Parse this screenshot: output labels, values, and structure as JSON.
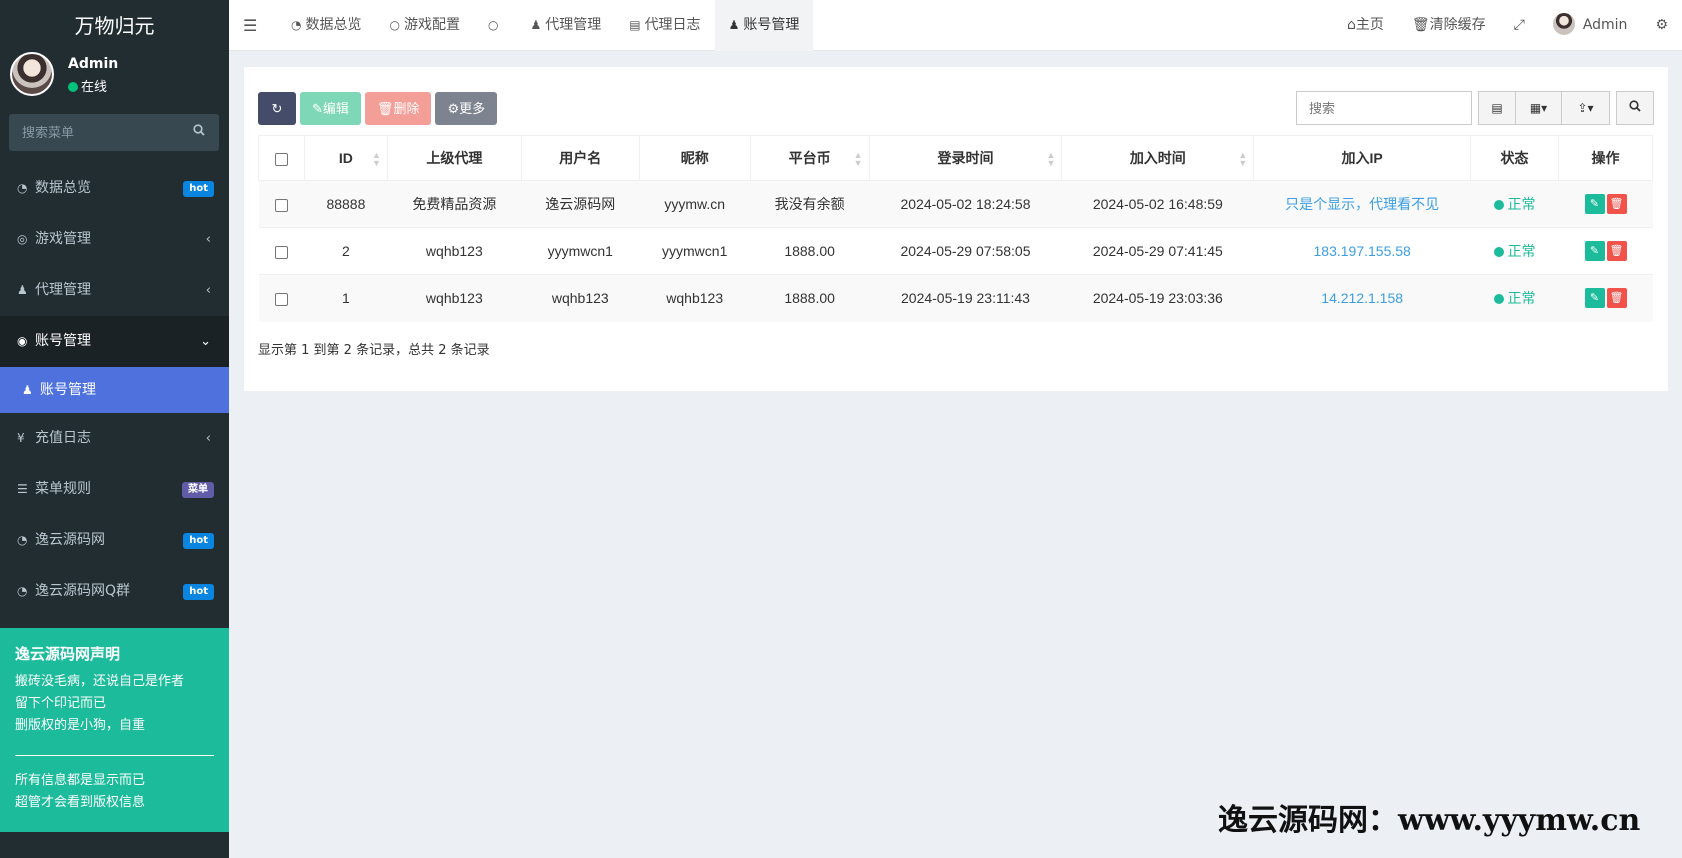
{
  "sidebar": {
    "logo": "万物归元",
    "user": {
      "name": "Admin",
      "status": "在线"
    },
    "search_placeholder": "搜索菜单",
    "items": [
      {
        "label": "数据总览",
        "badge": "hot",
        "icon": "dashboard-icon"
      },
      {
        "label": "游戏管理",
        "chevron": "‹",
        "icon": "gamepad-icon"
      },
      {
        "label": "代理管理",
        "chevron": "‹",
        "icon": "users-icon"
      },
      {
        "label": "账号管理",
        "chevron": "⌄",
        "icon": "user-circle-icon"
      },
      {
        "label": "账号管理",
        "icon": "user-icon"
      },
      {
        "label": "充值日志",
        "chevron": "‹",
        "icon": "yen-icon"
      },
      {
        "label": "菜单规则",
        "badge": "菜单",
        "icon": "list-icon"
      },
      {
        "label": "逸云源码网",
        "badge": "hot",
        "icon": "dashboard-icon"
      },
      {
        "label": "逸云源码网Q群",
        "badge": "hot",
        "icon": "dashboard-icon"
      }
    ],
    "notice": {
      "title": "逸云源码网声明",
      "lines": [
        "搬砖没毛病，还说自己是作者",
        "留下个印记而已",
        "删版权的是小狗，自重"
      ],
      "footer": [
        "所有信息都是显示而已",
        "超管才会看到版权信息"
      ]
    }
  },
  "topbar": {
    "tabs": [
      {
        "label": "数据总览",
        "icon": "dashboard-icon"
      },
      {
        "label": "游戏配置",
        "icon": "circle-icon"
      },
      {
        "label": "",
        "icon": "circle-icon"
      },
      {
        "label": "代理管理",
        "icon": "user-icon"
      },
      {
        "label": "代理日志",
        "icon": "list-alt-icon"
      },
      {
        "label": "账号管理",
        "icon": "user-icon"
      }
    ],
    "right": {
      "home": "主页",
      "clear_cache": "清除缓存",
      "user": "Admin"
    }
  },
  "toolbar": {
    "edit": "编辑",
    "delete": "删除",
    "more": "更多",
    "search_placeholder": "搜索"
  },
  "table": {
    "headers": [
      "ID",
      "上级代理",
      "用户名",
      "昵称",
      "平台币",
      "登录时间",
      "加入时间",
      "加入IP",
      "状态",
      "操作"
    ],
    "rows": [
      [
        "88888",
        "免费精品资源",
        "逸云源码网",
        "yyymw.cn",
        "我没有余额",
        "2024-05-02 18:24:58",
        "2024-05-02 16:48:59",
        "只是个显示，代理看不见",
        "正常"
      ],
      [
        "2",
        "wqhb123",
        "yyymwcn1",
        "yyymwcn1",
        "1888.00",
        "2024-05-29 07:58:05",
        "2024-05-29 07:41:45",
        "183.197.155.58",
        "正常"
      ],
      [
        "1",
        "wqhb123",
        "wqhb123",
        "wqhb123",
        "1888.00",
        "2024-05-19 23:11:43",
        "2024-05-19 23:03:36",
        "14.212.1.158",
        "正常"
      ]
    ],
    "summary": "显示第 1 到第 2 条记录，总共 2 条记录"
  },
  "watermark": "逸云源码网：www.yyymw.cn"
}
